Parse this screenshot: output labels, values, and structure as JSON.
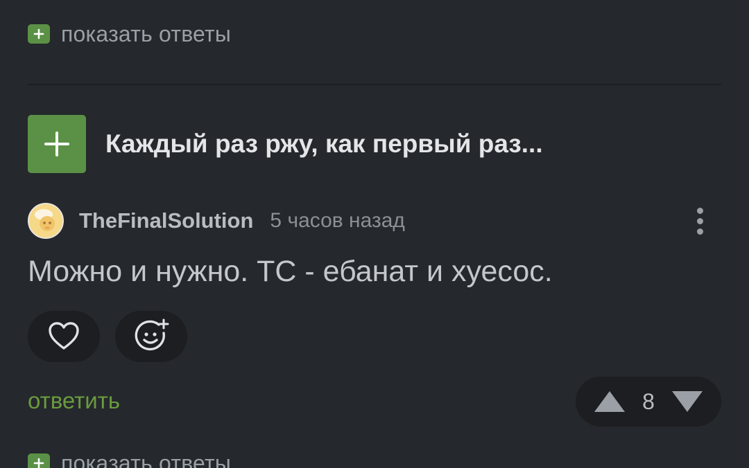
{
  "show_replies_top": {
    "label": "показать ответы"
  },
  "post": {
    "title": "Каждый раз ржу, как первый раз...",
    "author": "TheFinalSolution",
    "timestamp": "5 часов назад",
    "body": "Можно и нужно. ТС - ебанат и хуесос.",
    "reply_label": "ответить",
    "rating": "8"
  },
  "show_replies_bottom": {
    "label": "показать ответы"
  },
  "colors": {
    "background": "#25282c",
    "accent_green": "#5b9146",
    "reply_green": "#6a9b3f",
    "pill_bg": "#1c1e21"
  },
  "icons": {
    "expand": "plus-icon",
    "like": "heart-icon",
    "react": "emoji-add-icon",
    "more": "more-vertical-icon",
    "upvote": "triangle-up-icon",
    "downvote": "triangle-down-icon"
  }
}
